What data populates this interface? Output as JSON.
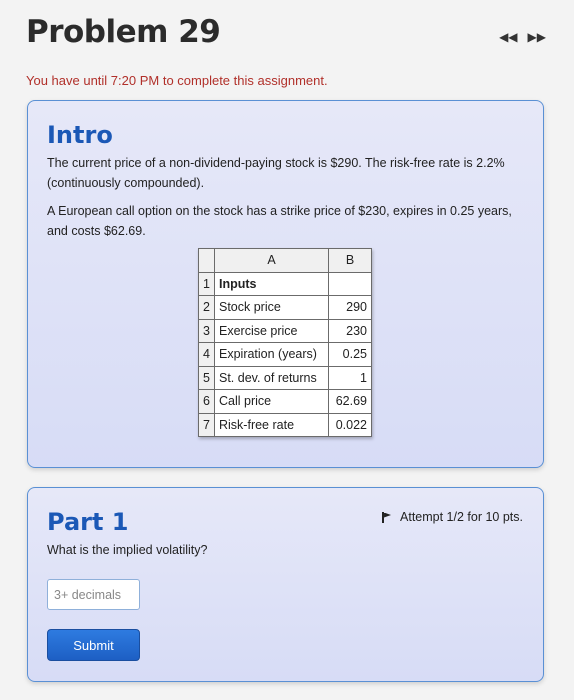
{
  "header": {
    "title": "Problem 29",
    "prev_label": "◀◀",
    "next_label": "▶▶"
  },
  "deadline": "You have until 7:20 PM to complete this assignment.",
  "intro": {
    "heading": "Intro",
    "paragraph1": "The current price of a non-dividend-paying stock is $290. The risk-free rate is 2.2% (continuously compounded).",
    "paragraph2": "A European call option on the stock has a strike price of $230, expires in 0.25 years, and costs $62.69.",
    "sheet": {
      "columns": [
        "A",
        "B"
      ],
      "rows": [
        {
          "num": "1",
          "a": "Inputs",
          "b": ""
        },
        {
          "num": "2",
          "a": "Stock price",
          "b": "290"
        },
        {
          "num": "3",
          "a": "Exercise price",
          "b": "230"
        },
        {
          "num": "4",
          "a": "Expiration (years)",
          "b": "0.25"
        },
        {
          "num": "5",
          "a": "St. dev. of returns",
          "b": "1"
        },
        {
          "num": "6",
          "a": "Call price",
          "b": "62.69"
        },
        {
          "num": "7",
          "a": "Risk-free rate",
          "b": "0.022"
        }
      ]
    }
  },
  "part1": {
    "heading": "Part 1",
    "attempt": "Attempt 1/2 for 10 pts.",
    "question": "What is the implied volatility?",
    "input_placeholder": "3+ decimals",
    "input_value": "",
    "submit_label": "Submit"
  },
  "colors": {
    "heading_blue": "#1b58b6",
    "deadline_red": "#b1302a",
    "card_border": "#5a90d4",
    "submit_blue": "#2e7be0"
  }
}
